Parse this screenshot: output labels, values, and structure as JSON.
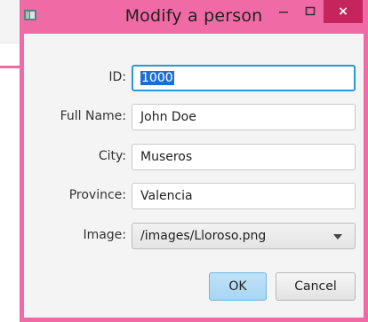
{
  "window": {
    "title": "Modify a person",
    "controls": {
      "minimize": "–",
      "maximize": "□",
      "close": "×"
    },
    "accent_color": "#f06aa6",
    "close_color": "#c5245d"
  },
  "form": {
    "id": {
      "label": "ID:",
      "value": "1000"
    },
    "full_name": {
      "label": "Full Name:",
      "value": "John Doe"
    },
    "city": {
      "label": "City:",
      "value": "Museros"
    },
    "province": {
      "label": "Province:",
      "value": "Valencia"
    },
    "image": {
      "label": "Image:",
      "selected": "/images/Lloroso.png"
    }
  },
  "buttons": {
    "ok": "OK",
    "cancel": "Cancel"
  }
}
